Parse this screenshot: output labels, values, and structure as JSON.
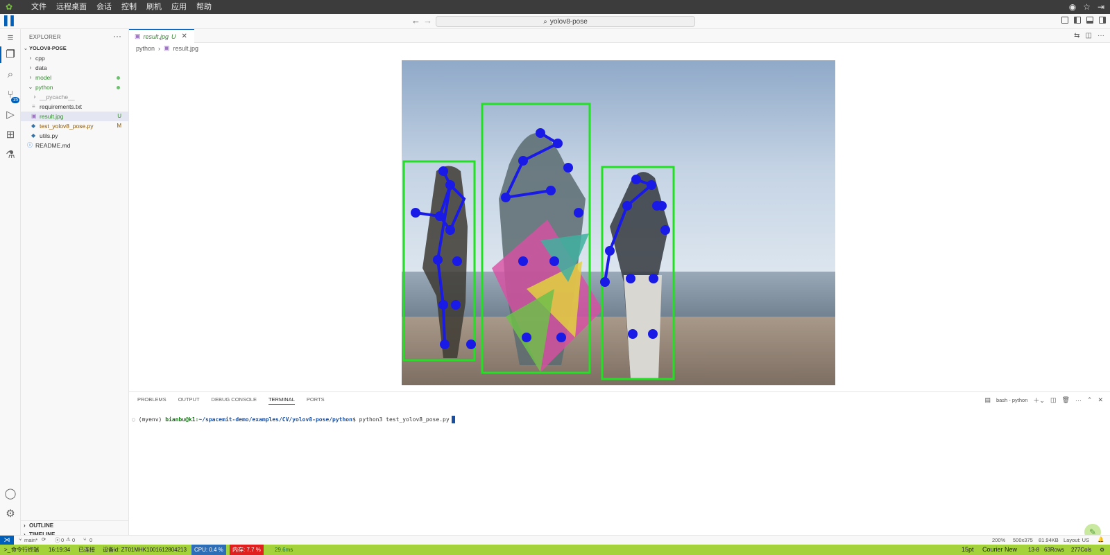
{
  "topbar": {
    "menus": [
      "文件",
      "远程桌面",
      "会话",
      "控制",
      "刷机",
      "应用",
      "帮助"
    ]
  },
  "titlebar": {
    "search_text": "yolov8-pose"
  },
  "activity": {
    "scm_badge": "15"
  },
  "explorer": {
    "title": "EXPLORER",
    "root": "YOLOV8-POSE",
    "items": [
      {
        "label": "cpp"
      },
      {
        "label": "data"
      },
      {
        "label": "model"
      },
      {
        "label": "python"
      },
      {
        "label": "__pycache__"
      },
      {
        "label": "requirements.txt"
      },
      {
        "label": "result.jpg",
        "status": "U"
      },
      {
        "label": "test_yolov8_pose.py",
        "status": "M"
      },
      {
        "label": "utils.py"
      },
      {
        "label": "README.md"
      }
    ],
    "outline": "OUTLINE",
    "timeline": "TIMELINE"
  },
  "editor": {
    "tab_label": "result.jpg",
    "tab_status": "U",
    "breadcrumb": [
      "python",
      "result.jpg"
    ]
  },
  "panel": {
    "tabs": [
      "PROBLEMS",
      "OUTPUT",
      "DEBUG CONSOLE",
      "TERMINAL",
      "PORTS"
    ],
    "terminal_name": "bash - python",
    "prompt_env": "(myenv)",
    "prompt_user": "bianbu@k1:",
    "prompt_path": "~/spacemit-demo/examples/CV/yolov8-pose/python",
    "prompt_end": "$",
    "command": "python3 test_yolov8_pose.py"
  },
  "statusbar": {
    "branch": "main*",
    "errors": "0",
    "warnings": "0",
    "ports": "0",
    "zoom": "200%",
    "dimensions": "500x375",
    "filesize": "81.94KB",
    "layout": "Layout: US"
  },
  "bottombar": {
    "terminal": "命令行终端",
    "time": "16:19:34",
    "connection": "已连接",
    "device": "设备id: ZT01MHK1001612804213",
    "cpu": "CPU: 0.4 %",
    "memory": "内存: 7.7 %",
    "latency": "29.6ms",
    "font_size": "15pt",
    "font_name": "Courier New",
    "position": "13-8",
    "rows": "63Rows",
    "cols": "277Cols"
  }
}
